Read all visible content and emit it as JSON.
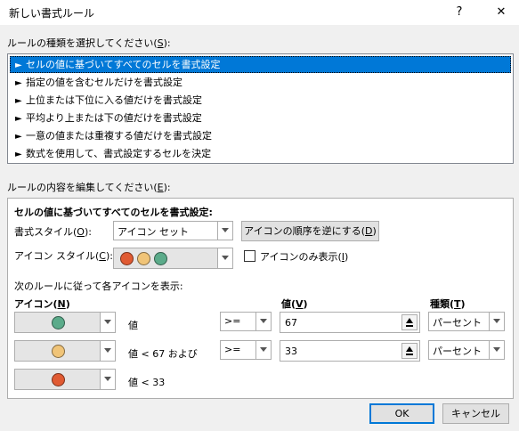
{
  "window": {
    "title": "新しい書式ルール",
    "help_glyph": "?",
    "close_glyph": "✕"
  },
  "rule_type": {
    "label_prefix": "ルールの種類を選択してください(",
    "label_key": "S",
    "label_suffix": "):",
    "items": [
      {
        "label": "セルの値に基づいてすべてのセルを書式設定",
        "selected": true
      },
      {
        "label": "指定の値を含むセルだけを書式設定",
        "selected": false
      },
      {
        "label": "上位または下位に入る値だけを書式設定",
        "selected": false
      },
      {
        "label": "平均より上または下の値だけを書式設定",
        "selected": false
      },
      {
        "label": "一意の値または重複する値だけを書式設定",
        "selected": false
      },
      {
        "label": "数式を使用して、書式設定するセルを決定",
        "selected": false
      }
    ],
    "item_arrow": "►"
  },
  "edit": {
    "label_prefix": "ルールの内容を編集してください(",
    "label_key": "E",
    "label_suffix": "):",
    "heading": "セルの値に基づいてすべてのセルを書式設定:",
    "format_style": {
      "label_prefix": "書式スタイル(",
      "label_key": "O",
      "label_suffix": "):",
      "value": "アイコン セット"
    },
    "reverse_button": {
      "prefix": "アイコンの順序を逆にする(",
      "key": "D",
      "suffix": ")"
    },
    "icon_style": {
      "label_prefix": "アイコン スタイル(",
      "label_key": "C",
      "label_suffix": "):",
      "colors": [
        "#e05a32",
        "#f0c478",
        "#5bab8a"
      ]
    },
    "show_icon_only": {
      "prefix": "アイコンのみ表示(",
      "key": "I",
      "suffix": ")",
      "checked": false
    },
    "rules_caption": "次のルールに従って各アイコンを表示:",
    "columns": {
      "icon_prefix": "アイコン(",
      "icon_key": "N",
      "icon_suffix": ")",
      "value_prefix": "値(",
      "value_key": "V",
      "value_suffix": ")",
      "type_prefix": "種類(",
      "type_key": "T",
      "type_suffix": ")"
    },
    "rules": [
      {
        "icon_color": "#5bab8a",
        "condition": "値",
        "operator": ">=",
        "value": "67",
        "type": "パーセント"
      },
      {
        "icon_color": "#f0c478",
        "condition": "値 < 67 および",
        "operator": ">=",
        "value": "33",
        "type": "パーセント"
      },
      {
        "icon_color": "#e05a32",
        "condition": "値 < 33"
      }
    ]
  },
  "footer": {
    "ok": "OK",
    "cancel": "キャンセル"
  }
}
